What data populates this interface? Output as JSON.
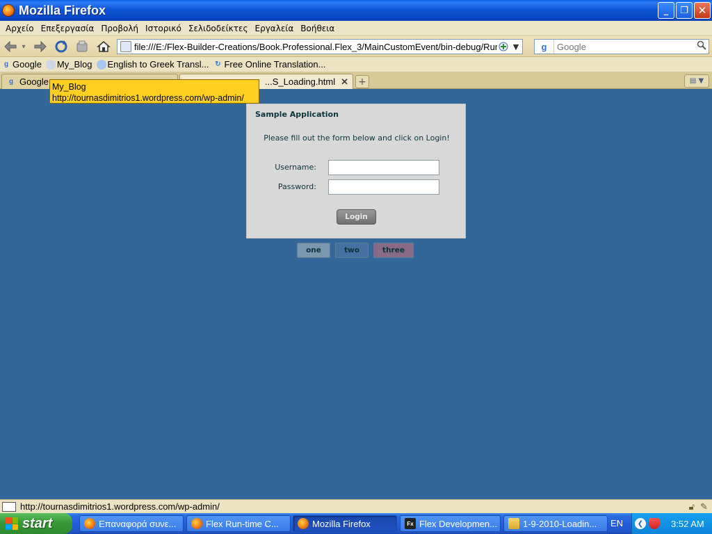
{
  "window": {
    "title": "Mozilla Firefox",
    "minimize": "_",
    "restore": "❐",
    "close": "✕"
  },
  "menu": [
    "Αρχείο",
    "Επεξεργασία",
    "Προβολή",
    "Ιστορικό",
    "Σελιδοδείκτες",
    "Εργαλεία",
    "Βοήθεια"
  ],
  "address": {
    "url": "file:///E:/Flex-Builder-Creations/Book.Professional.Flex_3/MainCustomEvent/bin-debug/Run"
  },
  "search": {
    "engine_icon": "g",
    "placeholder": "Google"
  },
  "bookmarks": [
    {
      "label": "Google",
      "icon": "google-icon"
    },
    {
      "label": "My_Blog",
      "icon": "user-icon"
    },
    {
      "label": "English to Greek Transl...",
      "icon": "globe-icon"
    },
    {
      "label": "Free Online Translation...",
      "icon": "refresh-icon"
    }
  ],
  "tabs": [
    {
      "label": "Google",
      "active": false
    },
    {
      "label": "...S_Loading.html",
      "active": true,
      "close": "✕"
    }
  ],
  "tooltip": {
    "line1": "My_Blog",
    "line2": "http://tournasdimitrios1.wordpress.com/wp-admin/"
  },
  "app": {
    "title": "Sample Application",
    "message": "Please fill out the form below and click on Login!",
    "username_label": "Username:",
    "password_label": "Password:",
    "username_value": "",
    "password_value": "",
    "login_label": "Login",
    "states": [
      {
        "label": "one",
        "color": "#7b97ad"
      },
      {
        "label": "two",
        "color": "#4670a0"
      },
      {
        "label": "three",
        "color": "#8a6a86"
      }
    ]
  },
  "status": {
    "text": "http://tournasdimitrios1.wordpress.com/wp-admin/"
  },
  "taskbar": {
    "start": "start",
    "tasks": [
      {
        "label": "Επαναφορά συνε...",
        "icon": "firefox-icon",
        "active": false
      },
      {
        "label": "Flex Run-time C...",
        "icon": "firefox-icon",
        "active": false
      },
      {
        "label": "Mozilla Firefox",
        "icon": "firefox-icon",
        "active": true
      },
      {
        "label": "Flex Developmen...",
        "icon": "flex-icon",
        "active": false
      },
      {
        "label": "1-9-2010-Loadin...",
        "icon": "folder-icon",
        "active": false
      }
    ],
    "language": "EN",
    "clock": "3:52 AM"
  }
}
